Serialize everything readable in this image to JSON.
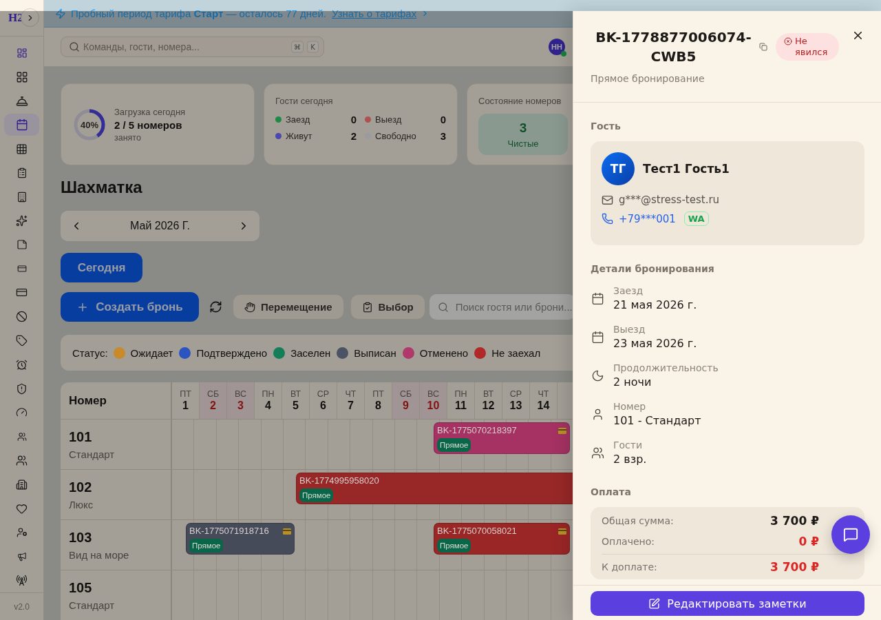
{
  "sidebar": {
    "logo": "H2",
    "items": [
      {
        "selected": false,
        "accent": true
      },
      {
        "selected": false,
        "accent": false
      },
      {
        "selected": false,
        "accent": false
      },
      {
        "selected": true,
        "accent": false
      },
      {
        "selected": false,
        "accent": false
      },
      {
        "selected": false,
        "accent": false
      },
      {
        "selected": false,
        "accent": false
      },
      {
        "selected": false,
        "accent": false
      },
      {
        "selected": false,
        "accent": false
      },
      {
        "selected": false,
        "accent": false
      },
      {
        "selected": false,
        "accent": false
      },
      {
        "selected": false,
        "accent": false
      },
      {
        "selected": false,
        "accent": false
      },
      {
        "selected": false,
        "accent": false
      },
      {
        "selected": false,
        "accent": false
      },
      {
        "selected": false,
        "accent": false
      },
      {
        "selected": false,
        "accent": false
      },
      {
        "selected": false,
        "accent": false
      },
      {
        "selected": false,
        "accent": false
      },
      {
        "selected": false,
        "accent": false
      },
      {
        "selected": false,
        "accent": false
      },
      {
        "selected": false,
        "accent": false
      },
      {
        "selected": false,
        "accent": false
      }
    ],
    "version": "v2.0"
  },
  "banner": {
    "text": "Пробный период тарифа **Старт** — осталось 77 дней.",
    "link": "Узнать о тарифах"
  },
  "header": {
    "search": {
      "placeholder": "Команды, гости, номера...",
      "keys": [
        "⌘",
        "K"
      ]
    },
    "user": {
      "initials": "НН",
      "online": true
    }
  },
  "stats": {
    "occupancy": {
      "title": "Загрузка сегодня",
      "percent": "40%",
      "level": 0.4,
      "value": "2 / 5 номеров",
      "caption": "занято"
    },
    "guests": {
      "title": "Гости сегодня",
      "items": [
        {
          "label": "Заезд",
          "value": "0",
          "color": "#1e8a45"
        },
        {
          "label": "Выезд",
          "value": "0",
          "color": "#b05050"
        },
        {
          "label": "Живут",
          "value": "2",
          "color": "#4a48b0"
        },
        {
          "label": "Свободно",
          "value": "3",
          "color": "#9a9aa0"
        }
      ]
    },
    "rooms": {
      "title": "Состояние номеров",
      "tiles": [
        {
          "value": "3",
          "label": "Чистые"
        }
      ]
    }
  },
  "page": {
    "title": "Шахматка",
    "month": "Май 2026 Г.",
    "today_button": "Сегодня"
  },
  "toolbar": {
    "create_button": "Создать бронь",
    "move_button": "Перемещение",
    "select_button": "Выбор",
    "search": {
      "placeholder": "Поиск гостя или брони..."
    }
  },
  "legend": {
    "label": "Статус:",
    "items": [
      {
        "label": "Ожидает",
        "color": "#c88a2a"
      },
      {
        "label": "Подтверждено",
        "color": "#2a55c0"
      },
      {
        "label": "Заселен",
        "color": "#147d5a"
      },
      {
        "label": "Выписан",
        "color": "#4a5264"
      },
      {
        "label": "Отменено",
        "color": "#b0386a"
      },
      {
        "label": "Не заехал",
        "color": "#b02828"
      }
    ]
  },
  "grid": {
    "room_header": "Номер",
    "days": [
      {
        "weekday": "ПТ",
        "day": "1",
        "weekend": false
      },
      {
        "weekday": "СБ",
        "day": "2",
        "weekend": true
      },
      {
        "weekday": "ВС",
        "day": "3",
        "weekend": true
      },
      {
        "weekday": "ПН",
        "day": "4",
        "weekend": false
      },
      {
        "weekday": "ВТ",
        "day": "5",
        "weekend": false
      },
      {
        "weekday": "СР",
        "day": "6",
        "weekend": false
      },
      {
        "weekday": "ЧТ",
        "day": "7",
        "weekend": false
      },
      {
        "weekday": "ПТ",
        "day": "8",
        "weekend": false
      },
      {
        "weekday": "СБ",
        "day": "9",
        "weekend": true
      },
      {
        "weekday": "ВС",
        "day": "10",
        "weekend": true
      },
      {
        "weekday": "ПН",
        "day": "11",
        "weekend": false
      },
      {
        "weekday": "ВТ",
        "day": "12",
        "weekend": false
      },
      {
        "weekday": "СР",
        "day": "13",
        "weekend": false
      },
      {
        "weekday": "ЧТ",
        "day": "14",
        "weekend": false
      }
    ],
    "rooms": [
      {
        "number": "101",
        "type": "Стандарт",
        "bookings": [
          {
            "code": "BK-1775070218397",
            "source": "Прямое",
            "color": "#a53262",
            "card": true
          }
        ]
      },
      {
        "number": "102",
        "type": "Люкс",
        "bookings": [
          {
            "code": "BK-1774995958020",
            "source": "Прямое",
            "color": "#982828"
          }
        ]
      },
      {
        "number": "103",
        "type": "Вид на море",
        "bookings": [
          {
            "code": "BK-1775071918716",
            "source": "Прямое",
            "color": "#454b59",
            "card": true
          },
          {
            "code": "BK-1775070058021",
            "source": "Прямое",
            "color": "#9a2626",
            "card": true
          }
        ]
      },
      {
        "number": "105",
        "type": "Стандарт"
      }
    ]
  },
  "drawer": {
    "title": "BK-1778877006074-CWB5",
    "status": {
      "label": "Не явился"
    },
    "subtitle": "Прямое бронирование",
    "guest": {
      "heading": "Гость",
      "initials": "ТГ",
      "name": "Тест1 Гость1",
      "email": "g***@stress-test.ru",
      "phone": "+79***001",
      "messenger": "WA"
    },
    "details": {
      "heading": "Детали бронирования",
      "items": [
        {
          "kind": "date",
          "label": "Заезд",
          "value": "21 мая 2026 г."
        },
        {
          "kind": "date",
          "label": "Выезд",
          "value": "23 мая 2026 г."
        },
        {
          "kind": "duration",
          "label": "Продолжительность",
          "value": "2 ночи"
        },
        {
          "kind": "room",
          "label": "Номер",
          "value": "101 - Стандарт"
        },
        {
          "kind": "guests",
          "label": "Гости",
          "value": "2 взр."
        }
      ]
    },
    "payment": {
      "heading": "Оплата",
      "rows": [
        {
          "label": "Общая сумма:",
          "value": "3 700 ₽",
          "due": false
        },
        {
          "label": "Оплачено:",
          "value": "0 ₽",
          "due": true
        },
        {
          "label": "К доплате:",
          "value": "3 700 ₽",
          "due": true
        }
      ]
    },
    "edit_button": "Редактировать заметки"
  }
}
